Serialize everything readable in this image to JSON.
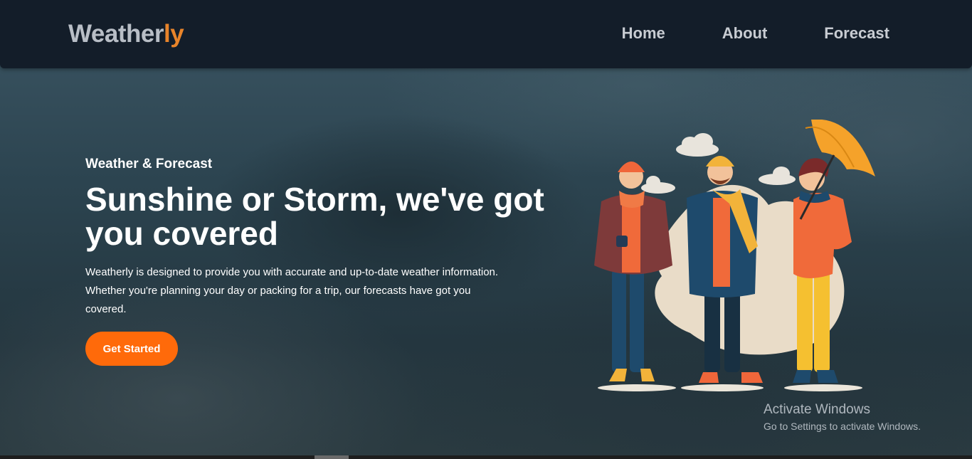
{
  "nav": {
    "logo_main": "Weather",
    "logo_accent": "ly",
    "links": [
      "Home",
      "About",
      "Forecast"
    ]
  },
  "hero": {
    "eyebrow": "Weather & Forecast",
    "headline": "Sunshine or Storm, we've got you covered",
    "description": "Weatherly is designed to provide you with accurate and up-to-date weather information. Whether you're planning your day or packing for a trip, our forecasts have got you covered.",
    "cta_label": "Get Started"
  },
  "illustration": {
    "subject": "three-people-cold-weather-umbrella-icon"
  },
  "watermark": {
    "title": "Activate Windows",
    "subtitle": "Go to Settings to activate Windows."
  },
  "colors": {
    "accent": "#ff6a0a",
    "logo_accent": "#e8842a",
    "navbar": "#131d29"
  }
}
